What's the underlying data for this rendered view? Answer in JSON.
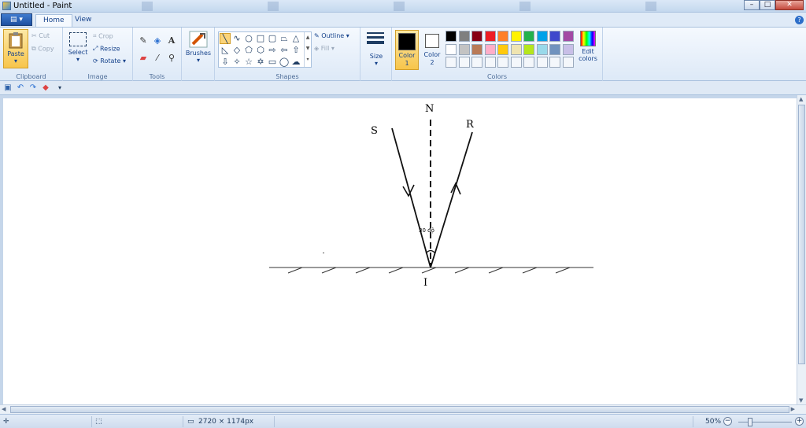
{
  "window": {
    "title": "Untitled - Paint",
    "buttons": [
      "minimize",
      "maximize",
      "close"
    ]
  },
  "tabs": {
    "home": "Home",
    "view": "View"
  },
  "ribbon": {
    "clipboard": {
      "label": "Clipboard",
      "paste": "Paste",
      "cut": "Cut",
      "copy": "Copy"
    },
    "image": {
      "label": "Image",
      "select": "Select",
      "crop": "Crop",
      "resize": "Resize",
      "rotate": "Rotate"
    },
    "tools": {
      "label": "Tools"
    },
    "brushes": {
      "label": "Brushes"
    },
    "shapes": {
      "label": "Shapes",
      "outline": "Outline",
      "fill": "Fill"
    },
    "size": {
      "label": "Size"
    },
    "colors": {
      "label": "Colors",
      "color1": "Color",
      "color1_num": "1",
      "color2": "Color",
      "color2_num": "2",
      "edit_colors_1": "Edit",
      "edit_colors_2": "colors",
      "color1_value": "#000000",
      "color2_value": "#ffffff",
      "palette_row1": [
        "#000000",
        "#7f7f7f",
        "#880015",
        "#ed1c24",
        "#ff7f27",
        "#fff200",
        "#22b14c",
        "#00a2e8",
        "#3f48cc",
        "#a349a4"
      ],
      "palette_row2": [
        "#ffffff",
        "#c3c3c3",
        "#b97a57",
        "#ffaec9",
        "#ffc90e",
        "#efe4b0",
        "#b5e61d",
        "#99d9ea",
        "#7092be",
        "#c8bfe7"
      ]
    }
  },
  "drawing": {
    "label_N": "N",
    "label_S": "S",
    "label_R": "R",
    "label_I": "I",
    "angle": "30 độ"
  },
  "status": {
    "dimensions": "2720 × 1174px",
    "zoom": "50%"
  }
}
